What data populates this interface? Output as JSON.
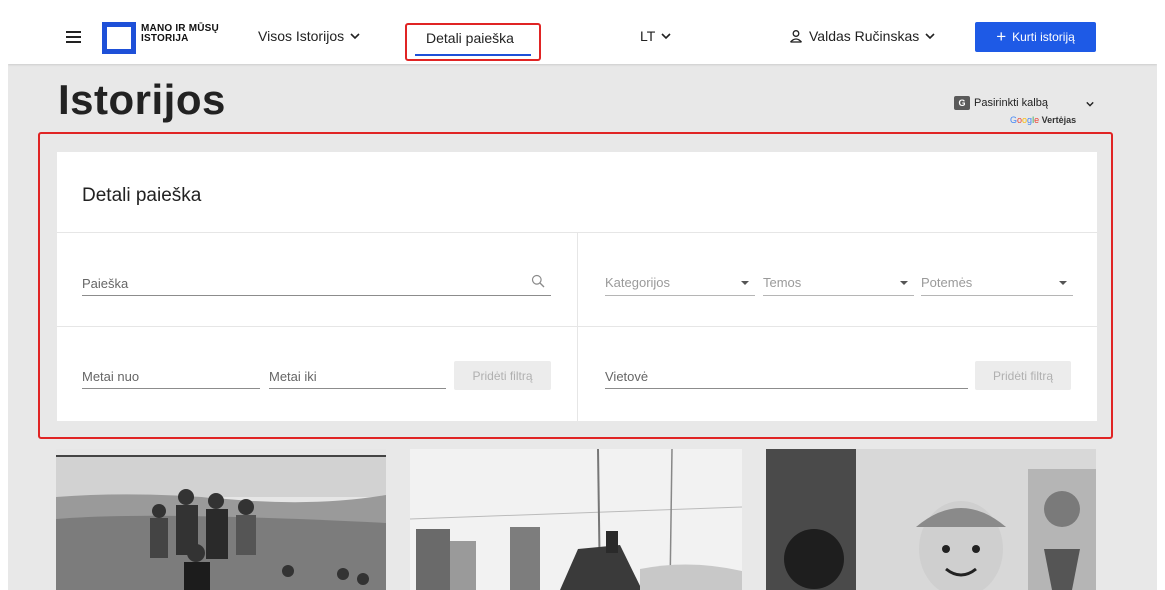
{
  "header": {
    "logo_line1": "MANO IR MŪSŲ",
    "logo_line2": "ISTORIJA",
    "nav_all_stories": "Visos Istorijos",
    "nav_detailed_search": "Detali paieška",
    "lang": "LT",
    "user_name": "Valdas Ručinskas",
    "create_button": "Kurti istoriją",
    "brand_color": "#1e5ae6"
  },
  "page": {
    "title": "Istorijos"
  },
  "translate": {
    "label": "Pasirinkti kalbą",
    "brand_suffix": "Vertėjas"
  },
  "search_panel": {
    "title": "Detali paieška",
    "search_placeholder": "Paieška",
    "categories": "Kategorijos",
    "themes": "Temos",
    "subthemes": "Potemės",
    "year_from_placeholder": "Metai nuo",
    "year_to_placeholder": "Metai iki",
    "add_filter_left": "Pridėti filtrą",
    "location_placeholder": "Vietovė",
    "add_filter_right": "Pridėti filtrą"
  },
  "icons": {
    "menu": "hamburger-icon",
    "search": "search-icon",
    "user": "user-icon",
    "translate": "google-translate-icon"
  }
}
